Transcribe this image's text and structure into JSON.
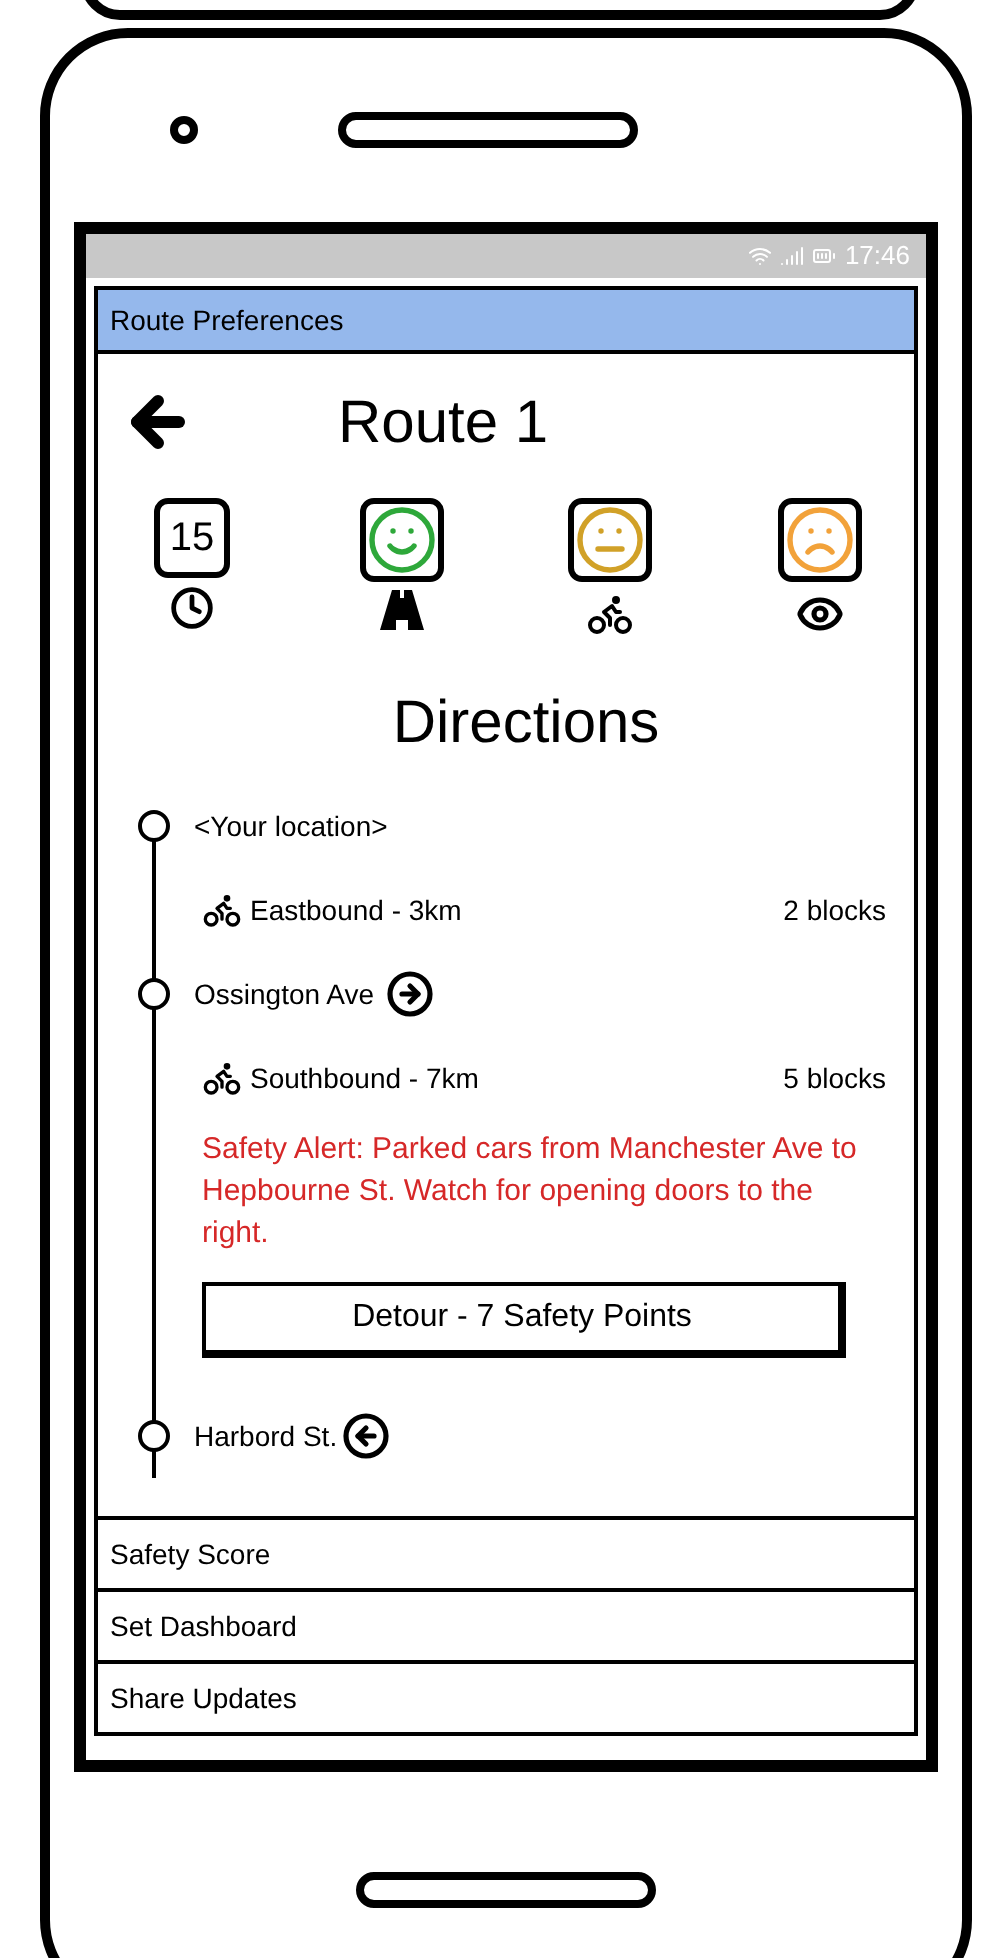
{
  "status_bar": {
    "time": "17:46"
  },
  "route_preferences": {
    "title": "Route Preferences",
    "expanded": true,
    "heading": "Route 1",
    "ratings": [
      {
        "kind": "number",
        "value": "15"
      },
      {
        "kind": "happy",
        "color": "#2ea83a"
      },
      {
        "kind": "neutral",
        "color": "#d1a128"
      },
      {
        "kind": "sad",
        "color": "#f2a23a"
      }
    ],
    "directions_title": "Directions",
    "steps": [
      {
        "kind": "stop",
        "name": "<Your location>"
      },
      {
        "kind": "leg",
        "text": "Eastbound - 3km",
        "blocks": "2 blocks"
      },
      {
        "kind": "rightturn",
        "name": "Ossington Ave"
      },
      {
        "kind": "leg",
        "text": "Southbound - 7km",
        "blocks": "5 blocks"
      },
      {
        "kind": "alert",
        "text": "Safety Alert: Parked cars from Manchester Ave to Hepbourne St. Watch for opening doors to the right."
      },
      {
        "kind": "button",
        "label": "Detour - 7 Safety Points"
      },
      {
        "kind": "leftturn",
        "name": "Harbord St."
      }
    ]
  },
  "sections": [
    {
      "title": "Safety Score",
      "expanded": false
    },
    {
      "title": "Set Dashboard",
      "expanded": false
    },
    {
      "title": "Share Updates",
      "expanded": false
    }
  ]
}
